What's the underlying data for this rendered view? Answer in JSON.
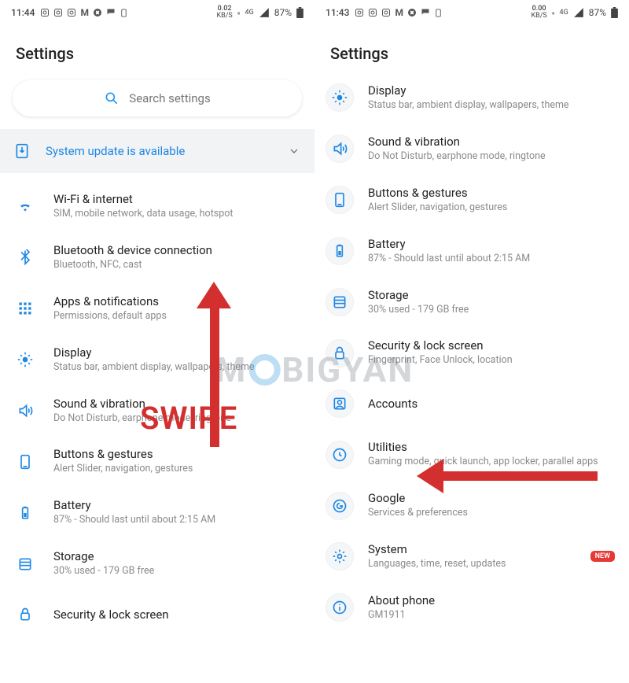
{
  "watermark": "MOBIGYAN",
  "annotations": {
    "swipe_label": "SWIPE"
  },
  "left": {
    "status": {
      "time": "11:44",
      "speed_value": "0.02",
      "speed_unit": "KB/S",
      "net": "4G",
      "battery_pct": "87%"
    },
    "title": "Settings",
    "search_placeholder": "Search settings",
    "banner": {
      "text": "System update is available"
    },
    "items": [
      {
        "icon": "wifi",
        "label": "Wi-Fi & internet",
        "sub": "SIM, mobile network, data usage, hotspot"
      },
      {
        "icon": "bluetooth",
        "label": "Bluetooth & device connection",
        "sub": "Bluetooth, NFC, cast"
      },
      {
        "icon": "apps",
        "label": "Apps & notifications",
        "sub": "Permissions, default apps"
      },
      {
        "icon": "display",
        "label": "Display",
        "sub": "Status bar, ambient display, wallpapers, theme"
      },
      {
        "icon": "sound",
        "label": "Sound & vibration",
        "sub": "Do Not Disturb, earphone mode, ringtone"
      },
      {
        "icon": "buttons",
        "label": "Buttons & gestures",
        "sub": "Alert Slider, navigation, gestures"
      },
      {
        "icon": "battery",
        "label": "Battery",
        "sub": "87% - Should last until about 2:15 AM"
      },
      {
        "icon": "storage",
        "label": "Storage",
        "sub": "30% used - 179 GB free"
      },
      {
        "icon": "security",
        "label": "Security & lock screen",
        "sub": ""
      }
    ]
  },
  "right": {
    "status": {
      "time": "11:43",
      "speed_value": "0.00",
      "speed_unit": "KB/S",
      "net": "4G",
      "battery_pct": "87%"
    },
    "title": "Settings",
    "items": [
      {
        "icon": "display",
        "label": "Display",
        "sub": "Status bar, ambient display, wallpapers, theme"
      },
      {
        "icon": "sound",
        "label": "Sound & vibration",
        "sub": "Do Not Disturb, earphone mode, ringtone"
      },
      {
        "icon": "buttons",
        "label": "Buttons & gestures",
        "sub": "Alert Slider, navigation, gestures"
      },
      {
        "icon": "battery",
        "label": "Battery",
        "sub": "87% - Should last until about 2:15 AM"
      },
      {
        "icon": "storage",
        "label": "Storage",
        "sub": "30% used - 179 GB free"
      },
      {
        "icon": "security",
        "label": "Security & lock screen",
        "sub": "Fingerprint, Face Unlock, location"
      },
      {
        "icon": "accounts",
        "label": "Accounts",
        "sub": ""
      },
      {
        "icon": "utilities",
        "label": "Utilities",
        "sub": "Gaming mode, quick launch, app locker, parallel apps"
      },
      {
        "icon": "google",
        "label": "Google",
        "sub": "Services & preferences"
      },
      {
        "icon": "system",
        "label": "System",
        "sub": "Languages, time, reset, updates",
        "badge": "NEW"
      },
      {
        "icon": "about",
        "label": "About phone",
        "sub": "GM1911"
      }
    ]
  }
}
